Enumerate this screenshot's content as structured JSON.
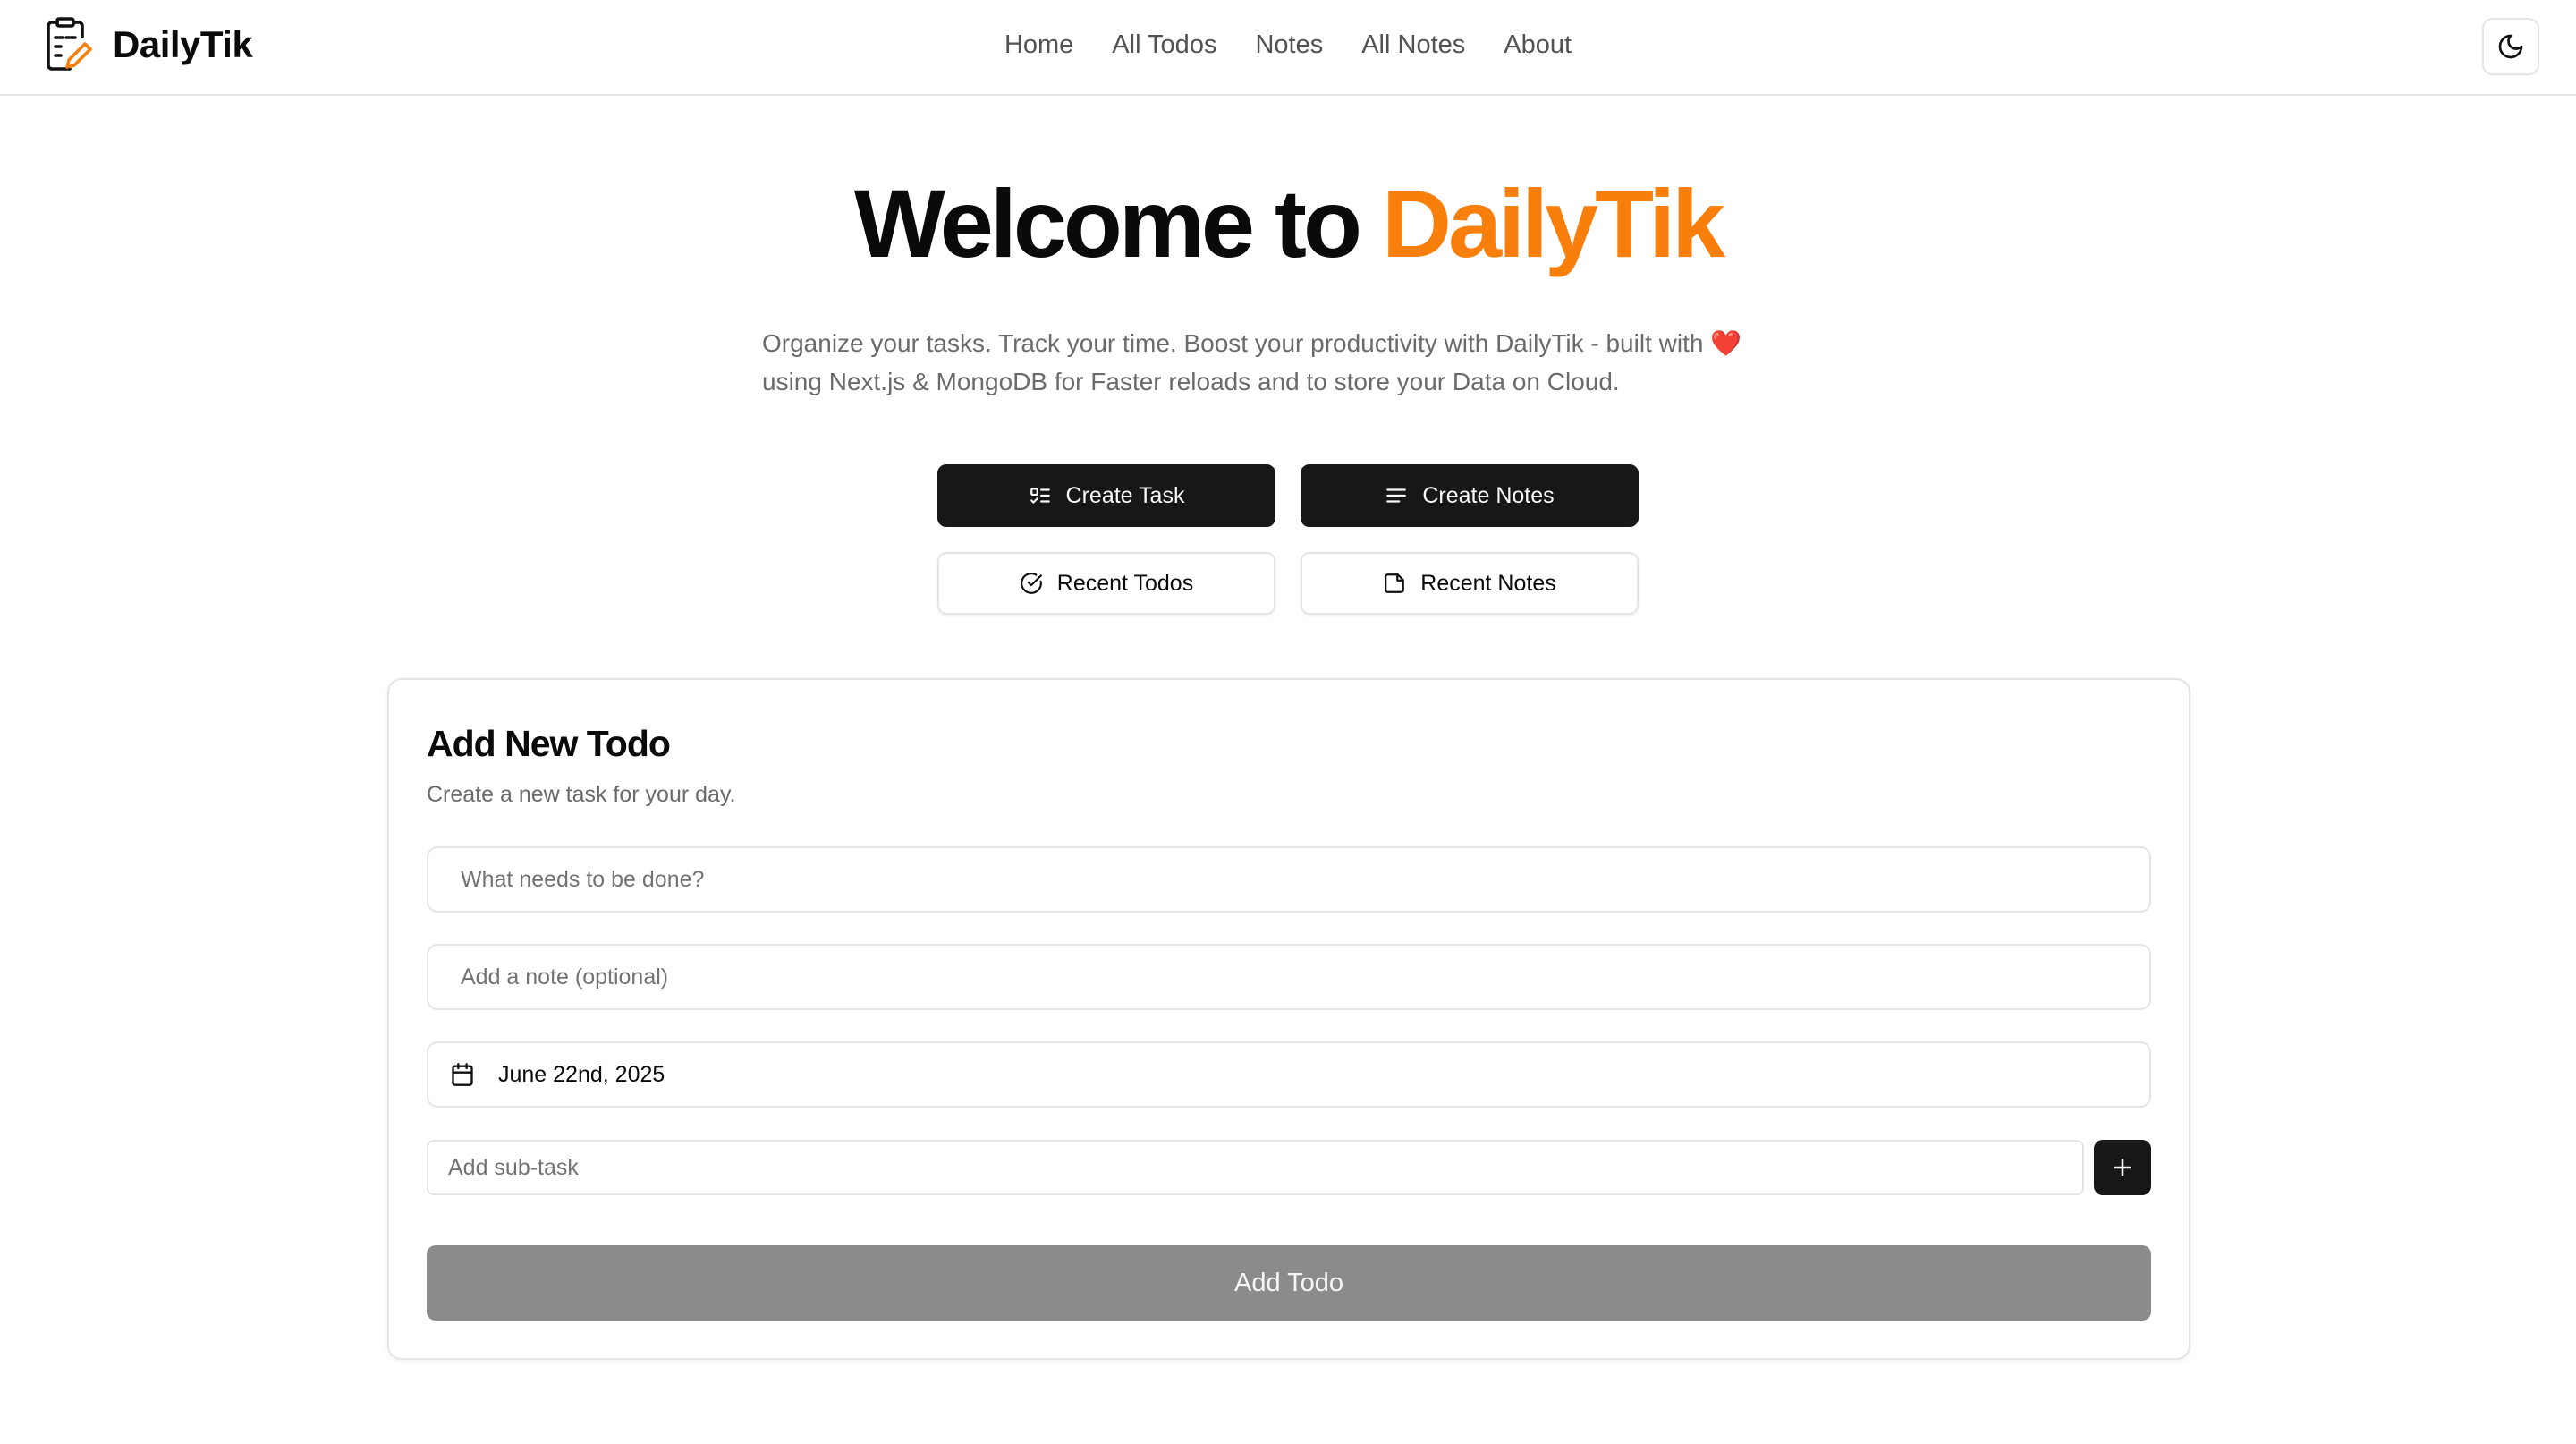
{
  "brand": {
    "name": "DailyTik"
  },
  "nav": [
    {
      "label": "Home"
    },
    {
      "label": "All Todos"
    },
    {
      "label": "Notes"
    },
    {
      "label": "All Notes"
    },
    {
      "label": "About"
    }
  ],
  "theme_toggle": {
    "icon": "moon-icon"
  },
  "hero": {
    "title_prefix": "Welcome to ",
    "title_accent": "DailyTik",
    "subtitle_line1": "Organize your tasks. Track your time. Boost your productivity with DailyTik - built with ",
    "heart": "❤️",
    "subtitle_line2": "using Next.js & MongoDB for Faster reloads and to store your Data on Cloud."
  },
  "actions": {
    "create_task": "Create Task",
    "create_notes": "Create Notes",
    "recent_todos": "Recent Todos",
    "recent_notes": "Recent Notes"
  },
  "form": {
    "title": "Add New Todo",
    "description": "Create a new task for your day.",
    "task_placeholder": "What needs to be done?",
    "note_placeholder": "Add a note (optional)",
    "date_value": "June 22nd, 2025",
    "subtask_placeholder": "Add sub-task",
    "submit_label": "Add Todo"
  },
  "colors": {
    "accent": "#f97f0d",
    "primary": "#171717",
    "disabled_button": "#8b8b8c",
    "border": "#e5e5e5",
    "muted_text": "#6b6b6b"
  }
}
